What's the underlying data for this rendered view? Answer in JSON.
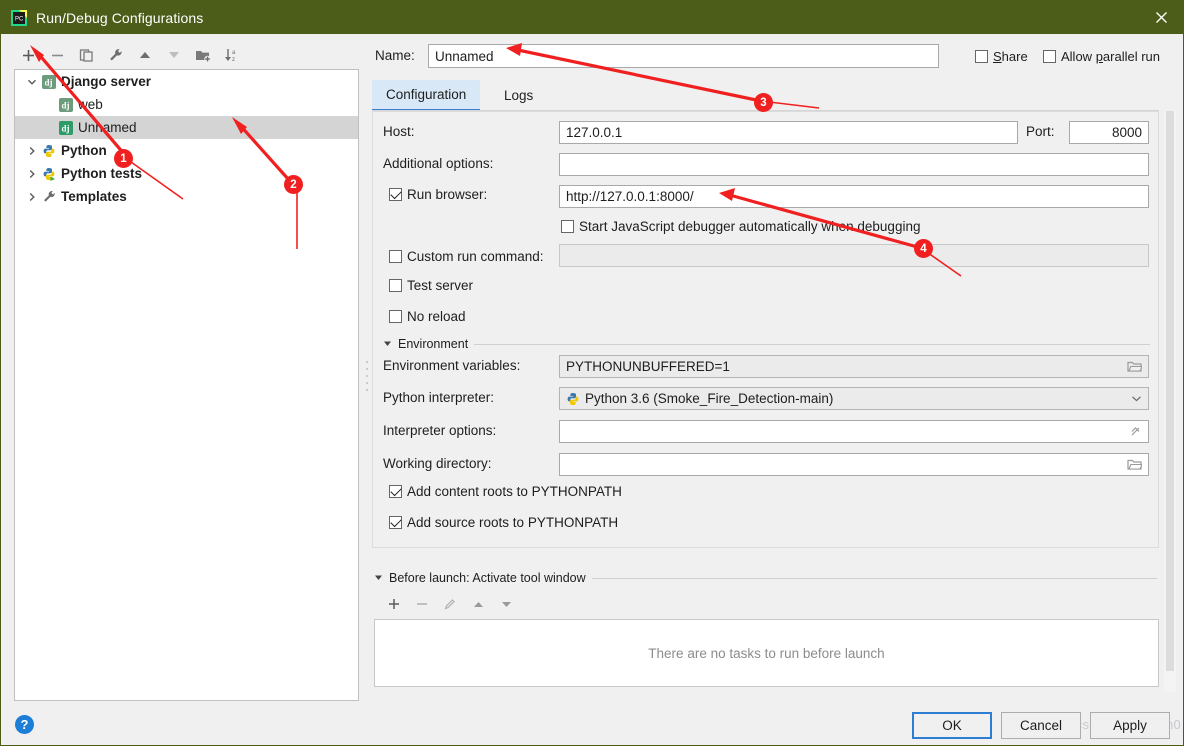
{
  "window": {
    "title": "Run/Debug Configurations",
    "app_icon": "pycharm-icon",
    "close_icon": "close-icon",
    "titlebar_color": "#4c5c19"
  },
  "left_toolbar": {
    "buttons": [
      {
        "name": "add-configuration-button",
        "icon": "plus-icon",
        "label": "+"
      },
      {
        "name": "remove-configuration-button",
        "icon": "minus-icon",
        "label": "−"
      },
      {
        "name": "copy-configuration-button",
        "icon": "copy-icon",
        "label": "Copy"
      },
      {
        "name": "edit-templates-button",
        "icon": "wrench-icon",
        "label": "Edit Templates"
      },
      {
        "name": "move-up-button",
        "icon": "triangle-up-icon",
        "label": "Move Up"
      },
      {
        "name": "move-down-button",
        "icon": "triangle-down-icon",
        "label": "Move Down"
      },
      {
        "name": "move-into-folder-button",
        "icon": "folder-add-icon",
        "label": "Move Into New Folder"
      },
      {
        "name": "sort-configurations-button",
        "icon": "sort-az-icon",
        "label": "Sort Configurations"
      }
    ]
  },
  "tree": {
    "items": [
      {
        "label": "Django server",
        "icon": "django-icon",
        "arrow": "chevron-down-icon",
        "level": 1,
        "bold": true,
        "selected": false
      },
      {
        "label": "web",
        "icon": "django-icon",
        "arrow": "",
        "level": 2,
        "bold": false,
        "selected": false
      },
      {
        "label": "Unnamed",
        "icon": "django-icon",
        "arrow": "",
        "level": 2,
        "bold": false,
        "selected": true
      },
      {
        "label": "Python",
        "icon": "python-icon",
        "arrow": "chevron-right-icon",
        "level": 1,
        "bold": true,
        "selected": false
      },
      {
        "label": "Python tests",
        "icon": "python-tests-icon",
        "arrow": "chevron-right-icon",
        "level": 1,
        "bold": true,
        "selected": false
      },
      {
        "label": "Templates",
        "icon": "wrench-icon",
        "arrow": "chevron-right-icon",
        "level": 1,
        "bold": true,
        "selected": false
      }
    ]
  },
  "name_row": {
    "label": "Name:",
    "value": "Unnamed",
    "placeholder": "",
    "share": {
      "label_before": "",
      "mnemonic": "S",
      "label_after": "hare",
      "checked": false
    },
    "parallel": {
      "label_before": "Allow ",
      "mnemonic": "p",
      "label_after": "arallel run",
      "checked": false
    }
  },
  "tabs": {
    "items": [
      {
        "label": "Configuration",
        "active": true
      },
      {
        "label": "Logs",
        "active": false
      }
    ]
  },
  "config": {
    "host": {
      "label": "Host:",
      "value": "127.0.0.1"
    },
    "port": {
      "label": "Port:",
      "value": "8000"
    },
    "additional_options": {
      "label": "Additional options:",
      "value": ""
    },
    "run_browser": {
      "label": "Run browser:",
      "checked": true,
      "value": "http://127.0.0.1:8000/"
    },
    "js_debugger": {
      "label": "Start JavaScript debugger automatically when debugging",
      "checked": false
    },
    "custom_run_command": {
      "label": "Custom run command:",
      "checked": false,
      "value": ""
    },
    "test_server": {
      "label": "Test server",
      "checked": false
    },
    "no_reload": {
      "label": "No reload",
      "checked": false
    },
    "environment_section": {
      "label": "Environment",
      "expanded": true
    },
    "env_vars": {
      "label": "Environment variables:",
      "value": "PYTHONUNBUFFERED=1",
      "trailing_icon": "folder-icon"
    },
    "python_interpreter": {
      "label": "Python interpreter:",
      "value": "Python 3.6 (Smoke_Fire_Detection-main)",
      "icon": "python-icon",
      "trailing_icon": "chevron-down-icon"
    },
    "interpreter_options": {
      "label": "Interpreter options:",
      "value": "",
      "trailing_icon": "expand-icon"
    },
    "working_directory": {
      "label": "Working directory:",
      "value": "",
      "trailing_icon": "folder-icon"
    },
    "add_content_roots": {
      "label": "Add content roots to PYTHONPATH",
      "checked": true
    },
    "add_source_roots": {
      "label": "Add source roots to PYTHONPATH",
      "checked": true
    }
  },
  "before_launch": {
    "section_label": "Before launch: Activate tool window",
    "expanded": true,
    "buttons": [
      {
        "name": "before-launch-add-button",
        "icon": "plus-icon",
        "label": "+"
      },
      {
        "name": "before-launch-remove-button",
        "icon": "minus-icon",
        "label": "−"
      },
      {
        "name": "before-launch-edit-button",
        "icon": "pencil-icon",
        "label": "Edit"
      },
      {
        "name": "before-launch-move-up-button",
        "icon": "triangle-up-icon",
        "label": "Move Up"
      },
      {
        "name": "before-launch-move-down-button",
        "icon": "triangle-down-icon",
        "label": "Move Down"
      }
    ],
    "empty_text": "There are no tasks to run before launch"
  },
  "footer": {
    "ok": "OK",
    "cancel": "Cancel",
    "apply": "Apply",
    "help_icon": "question-mark-icon",
    "watermark": "https://blog.csdn.net/@5h0h0n3dn3t"
  },
  "annotations": {
    "markers": [
      {
        "id": "1",
        "text": "1"
      },
      {
        "id": "2",
        "text": "2"
      },
      {
        "id": "3",
        "text": "3"
      },
      {
        "id": "4",
        "text": "4"
      }
    ],
    "color": "#f02020"
  }
}
